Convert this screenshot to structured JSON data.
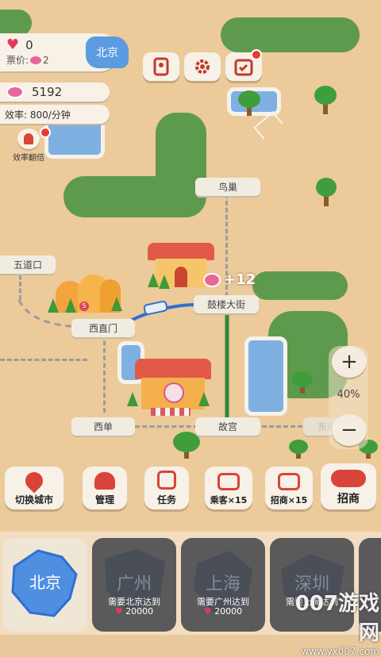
{
  "hud": {
    "hearts": "0",
    "ticket_label": "票价:",
    "ticket_value": "2",
    "city_badge": "北京",
    "coins": "5192",
    "efficiency": "效率: 800/分钟",
    "double_label": "效率翻倍"
  },
  "map": {
    "stations": {
      "niaochao": "鸟巢",
      "wudaokou": "五道口",
      "gulou": "鼓楼大街",
      "xizhimen": "西直门",
      "xidan": "西单",
      "gugong": "故宫",
      "dongdan": "东单"
    },
    "income_popup": "+12",
    "zoom_level": "40%",
    "zoom_in": "+",
    "zoom_out": "−"
  },
  "actions": [
    {
      "label": "切换城市"
    },
    {
      "label": "管理"
    },
    {
      "label": "任务"
    },
    {
      "label": "乘客×15"
    },
    {
      "label": "招商×15"
    },
    {
      "label": "招商"
    }
  ],
  "cities": [
    {
      "name": "北京",
      "active": true
    },
    {
      "name": "广州",
      "requirement": "需要北京达到",
      "cost": "20000"
    },
    {
      "name": "上海",
      "requirement": "需要广州达到",
      "cost": "20000"
    },
    {
      "name": "深圳",
      "requirement": "需要上海达到",
      "cost": "20000"
    }
  ],
  "watermark": "007游戏网",
  "watermark_url": "www.yx007.com",
  "colors": {
    "grass": "#5e9a4d",
    "water": "#7fb0e2",
    "sand": "#ecca9a",
    "roof": "#e25a47",
    "subway_blue": "#2f6fd1",
    "subway_green": "#2e8b3d"
  }
}
